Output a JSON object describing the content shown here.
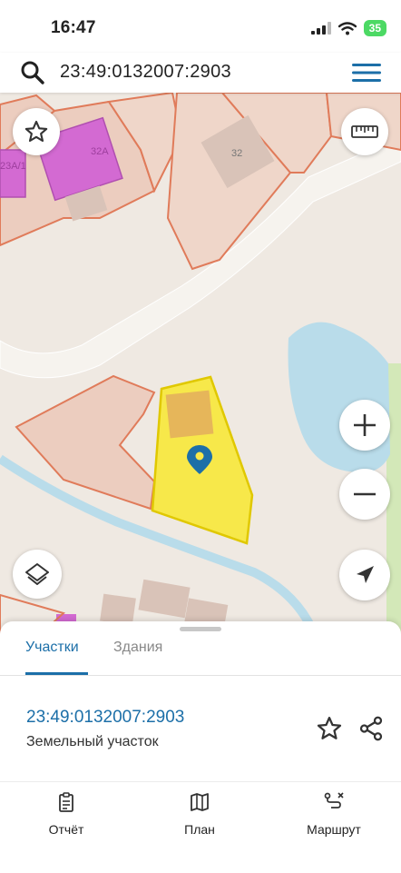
{
  "status_bar": {
    "time": "16:47",
    "battery": "35"
  },
  "search": {
    "query": "23:49:0132007:2903"
  },
  "map": {
    "labels": {
      "building_32": "32",
      "building_32a": "32А",
      "building_23a1": "23А/1"
    },
    "colors": {
      "selected_parcel": "#f7e84a",
      "parcel_border": "#e07b5a",
      "water": "#b9dcea",
      "building_purple": "#d36ad2"
    }
  },
  "tabs": [
    {
      "label": "Участки",
      "active": true
    },
    {
      "label": "Здания",
      "active": false
    }
  ],
  "parcel": {
    "id": "23:49:0132007:2903",
    "type": "Земельный участок"
  },
  "bottom_nav": [
    {
      "label": "Отчёт",
      "icon": "report-icon"
    },
    {
      "label": "План",
      "icon": "map-icon"
    },
    {
      "label": "Маршрут",
      "icon": "route-icon"
    }
  ],
  "accent_color": "#1c6fa8"
}
